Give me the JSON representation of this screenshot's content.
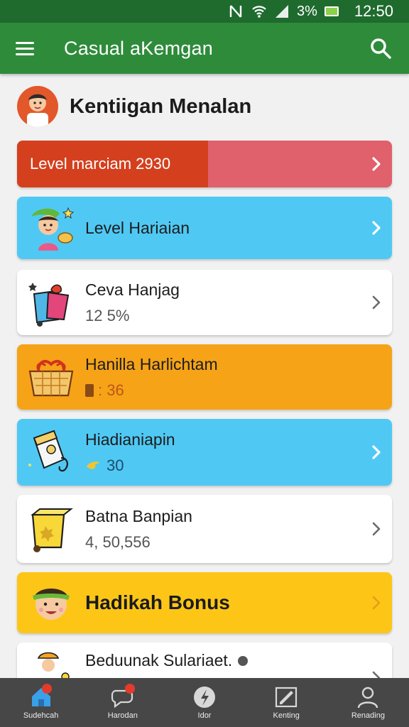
{
  "status_bar": {
    "battery_pct": "3%",
    "time": "12:50"
  },
  "app_bar": {
    "title": "Casual aKemgan"
  },
  "header": {
    "title": "Kentiigan Menalan"
  },
  "level_bar": {
    "label": "Level marciam 2930",
    "progress": 0.51
  },
  "cards": [
    {
      "title": "Level Hariaian",
      "subtitle": ""
    },
    {
      "title": "Ceva Hanjag",
      "subtitle": "12 5%"
    },
    {
      "title": "Hanilla Harlichtam",
      "subtitle": ": 36"
    },
    {
      "title": "Hiadianiapin",
      "subtitle": "30"
    },
    {
      "title": "Batna Banpian",
      "subtitle": "4, 50,556"
    },
    {
      "title": "Hadikah Bonus",
      "subtitle": ""
    },
    {
      "title": "Beduunak Sulariaet.",
      "subtitle": ""
    }
  ],
  "bottom_nav": [
    {
      "label": "Sudehcah",
      "icon": "home-icon",
      "badge": true
    },
    {
      "label": "Harodan",
      "icon": "chat-icon",
      "badge": true
    },
    {
      "label": "Idor",
      "icon": "bolt-icon",
      "badge": false
    },
    {
      "label": "Kenting",
      "icon": "edit-icon",
      "badge": false
    },
    {
      "label": "Renading",
      "icon": "profile-icon",
      "badge": false
    }
  ],
  "colors": {
    "status_bar": "#1f6b2e",
    "app_bar": "#2e8b3a",
    "level_fill": "#d4401e",
    "level_track": "#e0606c",
    "blue_card": "#4fc9f4",
    "orange_card": "#f6a318",
    "yellow_card": "#fdc617",
    "bottom_nav": "#474747"
  }
}
